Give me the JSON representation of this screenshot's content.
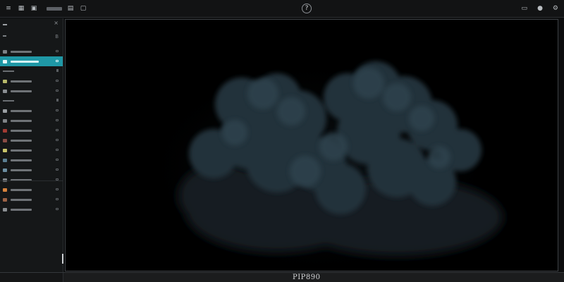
{
  "topbar": {
    "left_icons": [
      "hamburger-icon",
      "grid-icon",
      "folder-icon",
      "layers-icon",
      "window-icon"
    ],
    "left_glyphs": [
      "≡",
      "▦",
      "▣",
      "▤",
      "▢"
    ],
    "center_glyph": "?",
    "right_icons": [
      "monitor-icon",
      "user-icon",
      "settings-icon"
    ],
    "right_glyphs": [
      "▭",
      "●",
      "⚙"
    ]
  },
  "sidebar": {
    "header_close": "×",
    "header_badge": "B",
    "items": [
      {
        "type": "item",
        "icon": "image-icon",
        "icon_color": "#7c8085",
        "active": false
      },
      {
        "type": "item",
        "icon": "layers-icon",
        "icon_color": "#1f98a6",
        "active": true
      },
      {
        "type": "section"
      },
      {
        "type": "item",
        "icon": "circle-icon",
        "icon_color": "#b7b86a",
        "active": false
      },
      {
        "type": "item",
        "icon": "settings-icon",
        "icon_color": "#8a8e92",
        "active": false
      },
      {
        "type": "section"
      },
      {
        "type": "item",
        "icon": "eye-icon",
        "icon_color": "#9a9ea2",
        "active": false
      },
      {
        "type": "item",
        "icon": "target-icon",
        "icon_color": "#7f8387",
        "active": false
      },
      {
        "type": "item",
        "icon": "brush-icon",
        "icon_color": "#a13a32",
        "active": false
      },
      {
        "type": "item",
        "icon": "palette-icon",
        "icon_color": "#8a4b44",
        "active": false
      },
      {
        "type": "item",
        "icon": "star-icon",
        "icon_color": "#c9c46a",
        "active": false
      },
      {
        "type": "item",
        "icon": "grid-icon",
        "icon_color": "#5b7f92",
        "active": false
      },
      {
        "type": "item",
        "icon": "sliders-icon",
        "icon_color": "#6c8ea1",
        "active": false
      },
      {
        "type": "item",
        "icon": "shape-icon",
        "icon_color": "#7d8185",
        "active": false
      },
      {
        "type": "item",
        "icon": "swatch-icon",
        "icon_color": "#d7823c",
        "active": false
      },
      {
        "type": "item",
        "icon": "folder-icon",
        "icon_color": "#9b6246",
        "active": false
      },
      {
        "type": "item",
        "icon": "file-icon",
        "icon_color": "#8a8e92",
        "active": false
      }
    ]
  },
  "canvas": {
    "background": "#000000",
    "cloud_color": "#2a3a44"
  },
  "statusbar": {
    "label": "PIP890"
  }
}
